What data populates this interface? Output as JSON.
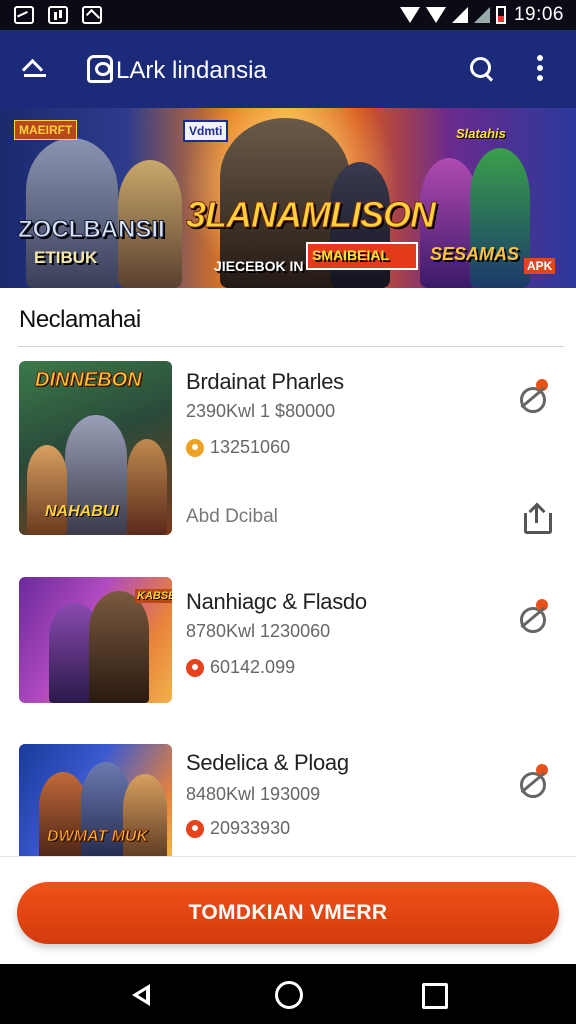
{
  "status_bar": {
    "time": "19:06"
  },
  "app_bar": {
    "title": "LArk lindansia"
  },
  "banner": {
    "tag_left": "MAEIRFT",
    "tag_mid": "Vdmti",
    "tag_right": "Slatahis",
    "title_left": "ZOCLBANSII",
    "subtitle_left": "ETIBUK",
    "title_center": "3LANAMLISON",
    "caption_a": "JIECEBOK IN",
    "caption_b": "SMAIBEIAL",
    "title_right": "SESAMAS",
    "badge": "APK"
  },
  "section": {
    "title": "Neclamahai"
  },
  "items": [
    {
      "title": "Brdainat Pharles",
      "meta": "2390Kwl 1 $80000",
      "downloads": "13251060",
      "author": "Abd Dcibal",
      "thumb_caption": "DINNEBON",
      "thumb_caption2": "NAHABUI",
      "coin_color": "#f0a020"
    },
    {
      "title": "Nanhiagc & Flasdo",
      "meta": "8780Kwl 1230060",
      "downloads": "60142.099",
      "thumb_caption": "KABSE",
      "coin_color": "#e8421a"
    },
    {
      "title": "Sedelica & Ploag",
      "meta": "8480Kwl 193009",
      "downloads": "20933930",
      "thumb_caption": "DWMAT MUK",
      "coin_color": "#e8421a"
    }
  ],
  "cta": {
    "label": "TOMDKIAN VMERR"
  }
}
